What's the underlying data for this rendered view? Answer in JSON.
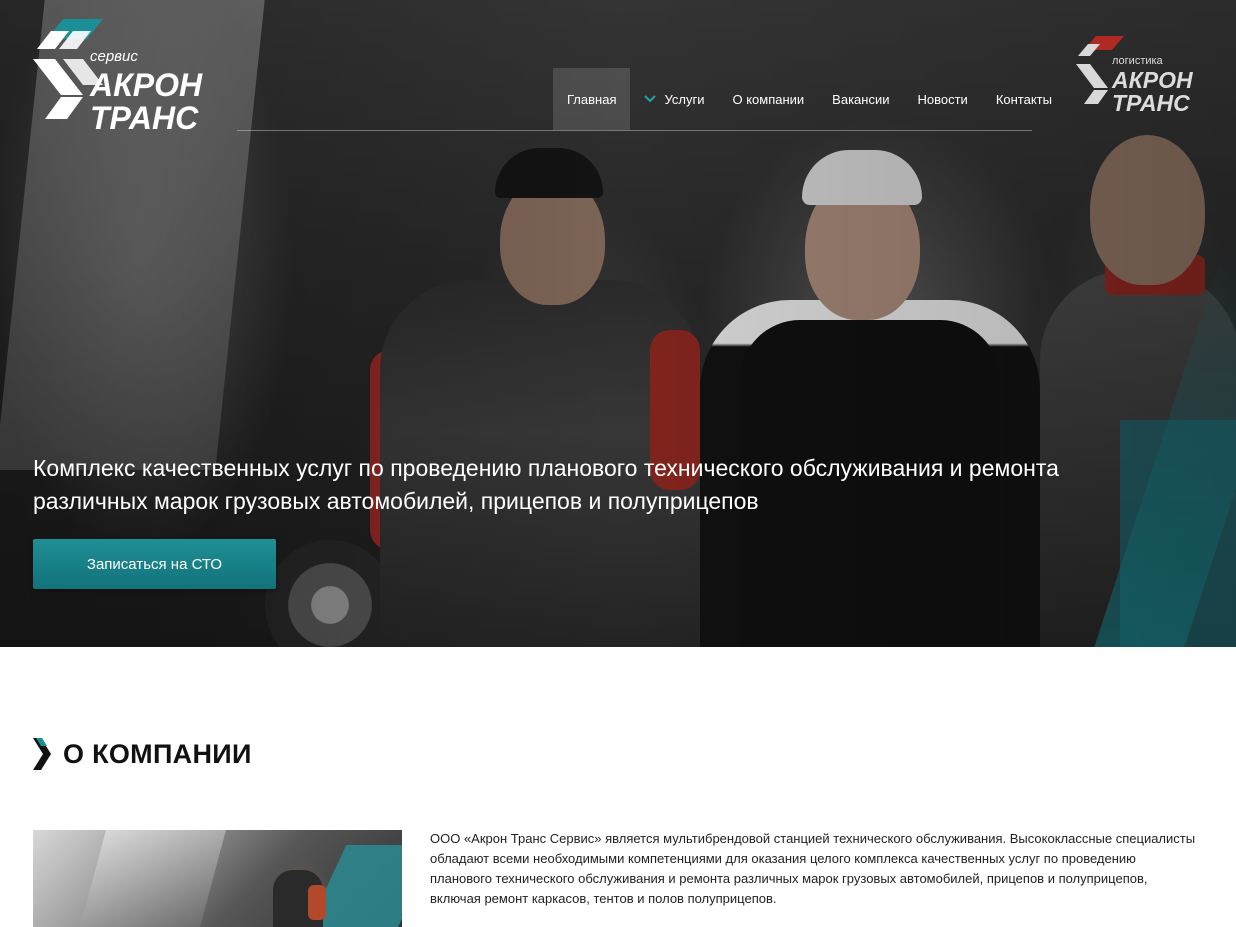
{
  "brand_left": {
    "small": "сервис",
    "line1": "АКРОН",
    "line2": "ТРАНС",
    "accent": "#1a8f98"
  },
  "brand_right": {
    "small": "логистика",
    "line1": "АКРОН",
    "line2": "ТРАНС",
    "accent": "#b02a24"
  },
  "nav": {
    "items": [
      {
        "label": "Главная",
        "active": true
      },
      {
        "label": "Услуги",
        "has_dropdown": true
      },
      {
        "label": "О компании"
      },
      {
        "label": "Вакансии"
      },
      {
        "label": "Новости"
      },
      {
        "label": "Контакты"
      }
    ]
  },
  "hero": {
    "title": "Комплекс качественных услуг по проведению планового технического обслуживания и ремонта различных марок грузовых автомобилей, прицепов и полуприцепов",
    "cta_label": "Записаться на СТО",
    "cta_color": "#16808a"
  },
  "about": {
    "heading": "О КОМПАНИИ",
    "text": "ООО «Акрон Транс Сервис» является мультибрендовой станцией технического обслуживания. Высококлассные специалисты обладают всеми необходимыми компетенциями для оказания целого комплекса качественных услуг по проведению планового технического обслуживания и ремонта различных марок грузовых автомобилей, прицепов и полуприцепов, включая ремонт каркасов, тентов и полов полуприцепов."
  }
}
